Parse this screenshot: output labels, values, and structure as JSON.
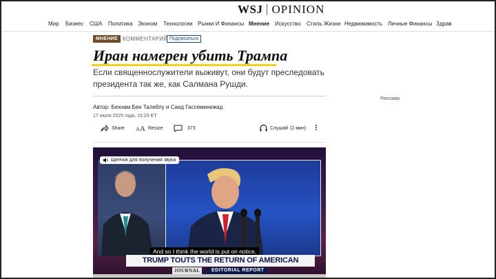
{
  "logo": {
    "brand": "WSJ",
    "section": "OPINION"
  },
  "nav": {
    "items": [
      "Мир",
      "Бизнес",
      "США",
      "Политика",
      "Эконом",
      "Технологии",
      "Рынки И Финансы",
      "Мнение",
      "Искусство",
      "Стиль Жизни",
      "Недвижимость",
      "Личные Финансы",
      "Здрав"
    ],
    "active": "Мнение"
  },
  "tags": {
    "opinion": "МНЕНИЕ",
    "commentary": "КОММЕНТАРИЙ",
    "subscribe": "Подписаться"
  },
  "article": {
    "headline": "Иран намерен убить Трампа",
    "dek": "Если священнослужители выживут, они будут преследовать президента так же, как Салмана Рушди.",
    "byline": "Автор: Бехнам Бен Талеблу и Саид Гассеминежад",
    "date": "17 июля 2025 года, 15:29 ET"
  },
  "ad_label": "Реклама",
  "toolbar": {
    "share": "Share",
    "resize": "Resize",
    "comments": "373",
    "listen": "Слушай",
    "duration": "(2 мин)"
  },
  "video": {
    "sound_button": "Щелчок для получения звука",
    "caption": "And so I think the world is put on notice,",
    "banner": "TRUMP TOUTS THE RETURN OF AMERICAN DETERRENCE",
    "journal": "JOURNAL",
    "editorial": "EDITORIAL REPORT"
  },
  "icons": {
    "share": "share-arrow-icon",
    "resize": "text-resize-icon",
    "comments": "comment-bubble-icon",
    "listen": "headphones-icon",
    "more": "more-vertical-icon",
    "sound": "speaker-icon"
  },
  "colors": {
    "opinion_tag": "#6b4b2a",
    "headline_underline": "#f2d21d",
    "subscribe": "#1a4a7a"
  }
}
